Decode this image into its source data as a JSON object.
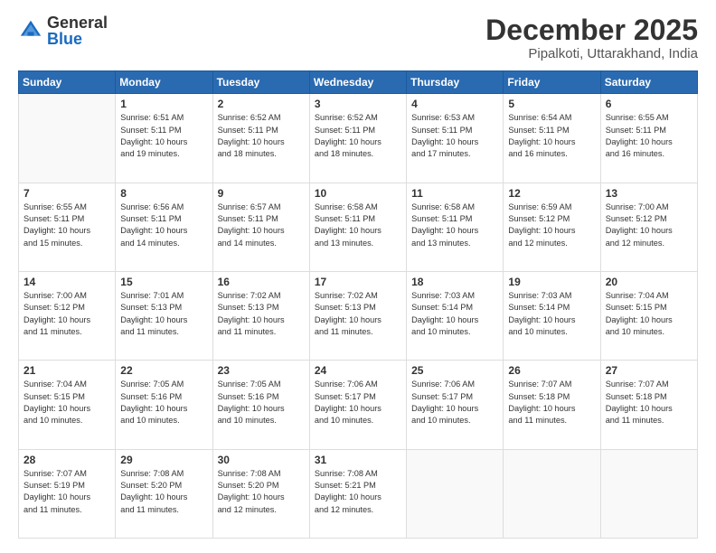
{
  "logo": {
    "general": "General",
    "blue": "Blue"
  },
  "header": {
    "month": "December 2025",
    "location": "Pipalkoti, Uttarakhand, India"
  },
  "weekdays": [
    "Sunday",
    "Monday",
    "Tuesday",
    "Wednesday",
    "Thursday",
    "Friday",
    "Saturday"
  ],
  "weeks": [
    [
      {
        "day": "",
        "info": ""
      },
      {
        "day": "1",
        "info": "Sunrise: 6:51 AM\nSunset: 5:11 PM\nDaylight: 10 hours\nand 19 minutes."
      },
      {
        "day": "2",
        "info": "Sunrise: 6:52 AM\nSunset: 5:11 PM\nDaylight: 10 hours\nand 18 minutes."
      },
      {
        "day": "3",
        "info": "Sunrise: 6:52 AM\nSunset: 5:11 PM\nDaylight: 10 hours\nand 18 minutes."
      },
      {
        "day": "4",
        "info": "Sunrise: 6:53 AM\nSunset: 5:11 PM\nDaylight: 10 hours\nand 17 minutes."
      },
      {
        "day": "5",
        "info": "Sunrise: 6:54 AM\nSunset: 5:11 PM\nDaylight: 10 hours\nand 16 minutes."
      },
      {
        "day": "6",
        "info": "Sunrise: 6:55 AM\nSunset: 5:11 PM\nDaylight: 10 hours\nand 16 minutes."
      }
    ],
    [
      {
        "day": "7",
        "info": "Sunrise: 6:55 AM\nSunset: 5:11 PM\nDaylight: 10 hours\nand 15 minutes."
      },
      {
        "day": "8",
        "info": "Sunrise: 6:56 AM\nSunset: 5:11 PM\nDaylight: 10 hours\nand 14 minutes."
      },
      {
        "day": "9",
        "info": "Sunrise: 6:57 AM\nSunset: 5:11 PM\nDaylight: 10 hours\nand 14 minutes."
      },
      {
        "day": "10",
        "info": "Sunrise: 6:58 AM\nSunset: 5:11 PM\nDaylight: 10 hours\nand 13 minutes."
      },
      {
        "day": "11",
        "info": "Sunrise: 6:58 AM\nSunset: 5:11 PM\nDaylight: 10 hours\nand 13 minutes."
      },
      {
        "day": "12",
        "info": "Sunrise: 6:59 AM\nSunset: 5:12 PM\nDaylight: 10 hours\nand 12 minutes."
      },
      {
        "day": "13",
        "info": "Sunrise: 7:00 AM\nSunset: 5:12 PM\nDaylight: 10 hours\nand 12 minutes."
      }
    ],
    [
      {
        "day": "14",
        "info": "Sunrise: 7:00 AM\nSunset: 5:12 PM\nDaylight: 10 hours\nand 11 minutes."
      },
      {
        "day": "15",
        "info": "Sunrise: 7:01 AM\nSunset: 5:13 PM\nDaylight: 10 hours\nand 11 minutes."
      },
      {
        "day": "16",
        "info": "Sunrise: 7:02 AM\nSunset: 5:13 PM\nDaylight: 10 hours\nand 11 minutes."
      },
      {
        "day": "17",
        "info": "Sunrise: 7:02 AM\nSunset: 5:13 PM\nDaylight: 10 hours\nand 11 minutes."
      },
      {
        "day": "18",
        "info": "Sunrise: 7:03 AM\nSunset: 5:14 PM\nDaylight: 10 hours\nand 10 minutes."
      },
      {
        "day": "19",
        "info": "Sunrise: 7:03 AM\nSunset: 5:14 PM\nDaylight: 10 hours\nand 10 minutes."
      },
      {
        "day": "20",
        "info": "Sunrise: 7:04 AM\nSunset: 5:15 PM\nDaylight: 10 hours\nand 10 minutes."
      }
    ],
    [
      {
        "day": "21",
        "info": "Sunrise: 7:04 AM\nSunset: 5:15 PM\nDaylight: 10 hours\nand 10 minutes."
      },
      {
        "day": "22",
        "info": "Sunrise: 7:05 AM\nSunset: 5:16 PM\nDaylight: 10 hours\nand 10 minutes."
      },
      {
        "day": "23",
        "info": "Sunrise: 7:05 AM\nSunset: 5:16 PM\nDaylight: 10 hours\nand 10 minutes."
      },
      {
        "day": "24",
        "info": "Sunrise: 7:06 AM\nSunset: 5:17 PM\nDaylight: 10 hours\nand 10 minutes."
      },
      {
        "day": "25",
        "info": "Sunrise: 7:06 AM\nSunset: 5:17 PM\nDaylight: 10 hours\nand 10 minutes."
      },
      {
        "day": "26",
        "info": "Sunrise: 7:07 AM\nSunset: 5:18 PM\nDaylight: 10 hours\nand 11 minutes."
      },
      {
        "day": "27",
        "info": "Sunrise: 7:07 AM\nSunset: 5:18 PM\nDaylight: 10 hours\nand 11 minutes."
      }
    ],
    [
      {
        "day": "28",
        "info": "Sunrise: 7:07 AM\nSunset: 5:19 PM\nDaylight: 10 hours\nand 11 minutes."
      },
      {
        "day": "29",
        "info": "Sunrise: 7:08 AM\nSunset: 5:20 PM\nDaylight: 10 hours\nand 11 minutes."
      },
      {
        "day": "30",
        "info": "Sunrise: 7:08 AM\nSunset: 5:20 PM\nDaylight: 10 hours\nand 12 minutes."
      },
      {
        "day": "31",
        "info": "Sunrise: 7:08 AM\nSunset: 5:21 PM\nDaylight: 10 hours\nand 12 minutes."
      },
      {
        "day": "",
        "info": ""
      },
      {
        "day": "",
        "info": ""
      },
      {
        "day": "",
        "info": ""
      }
    ]
  ]
}
